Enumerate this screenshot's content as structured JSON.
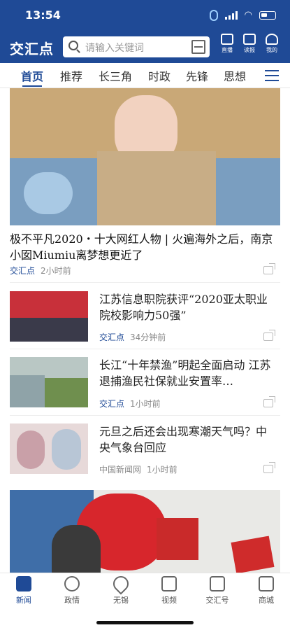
{
  "status": {
    "time": "13:54"
  },
  "header": {
    "logo": "交汇点",
    "search_placeholder": "请输入关键词",
    "tools": [
      {
        "label": "直播",
        "icon": "live-tv-icon"
      },
      {
        "label": "读报",
        "icon": "newspaper-icon"
      },
      {
        "label": "我的",
        "icon": "user-icon"
      }
    ]
  },
  "tabs": [
    "首页",
    "推荐",
    "长三角",
    "时政",
    "先锋",
    "思想"
  ],
  "hero": {
    "title": "极不平凡2020・十大网红人物 | 火遍海外之后，南京小囡Miumiu离梦想更近了",
    "source": "交汇点",
    "time": "2小时前"
  },
  "news": [
    {
      "title": "江苏信息职院获评“2020亚太职业院校影响力50强”",
      "source": "交汇点",
      "time": "34分钟前"
    },
    {
      "title": "长江“十年禁渔”明起全面启动 江苏退捕渔民社保就业安置率…",
      "source": "交汇点",
      "time": "1小时前"
    },
    {
      "title": "元旦之后还会出现寒潮天气吗？中央气象台回应",
      "source": "中国新闻网",
      "time": "1小时前"
    }
  ],
  "bottom_nav": [
    {
      "label": "新闻",
      "icon": "news-icon",
      "active": true
    },
    {
      "label": "政情",
      "icon": "star-icon"
    },
    {
      "label": "无锡",
      "icon": "location-icon"
    },
    {
      "label": "视频",
      "icon": "video-icon"
    },
    {
      "label": "交汇号",
      "icon": "channel-icon"
    },
    {
      "label": "商城",
      "icon": "shop-icon"
    }
  ],
  "colors": {
    "brand": "#1f4a96",
    "meta": "#888888"
  }
}
